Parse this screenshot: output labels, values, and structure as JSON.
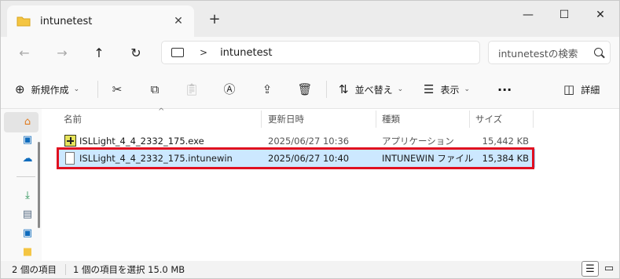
{
  "window": {
    "tab_title": "intunetest",
    "close_tab": "✕",
    "new_tab": "+",
    "minimize": "—",
    "maximize": "☐",
    "close": "✕"
  },
  "nav": {
    "back": "←",
    "forward": "→",
    "up": "↑",
    "refresh": "↻",
    "separator": ">",
    "path": "intunetest",
    "search_placeholder": "intunetestの検索"
  },
  "commands": {
    "new_label": "新規作成",
    "sort_label": "並べ替え",
    "view_label": "表示",
    "more": "···",
    "details_label": "詳細"
  },
  "columns": {
    "name": "名前",
    "date": "更新日時",
    "type": "種類",
    "size": "サイズ"
  },
  "files": [
    {
      "name": "ISLLight_4_4_2332_175.exe",
      "date": "2025/06/27 10:36",
      "type": "アプリケーション",
      "size": "15,442 KB",
      "icon": "exe-icon",
      "selected": false
    },
    {
      "name": "ISLLight_4_4_2332_175.intunewin",
      "date": "2025/06/27 10:40",
      "type": "INTUNEWIN ファイル",
      "size": "15,384 KB",
      "icon": "document-icon",
      "selected": true
    }
  ],
  "status": {
    "item_count": "2 個の項目",
    "selection": "1 個の項目を選択  15.0 MB"
  },
  "colors": {
    "selection_bg": "#cce8ff",
    "highlight_box": "#e01020",
    "onedrive_blue": "#0f6cbd",
    "download_green": "#1d8a4c",
    "folder_yellow": "#f4c542"
  }
}
